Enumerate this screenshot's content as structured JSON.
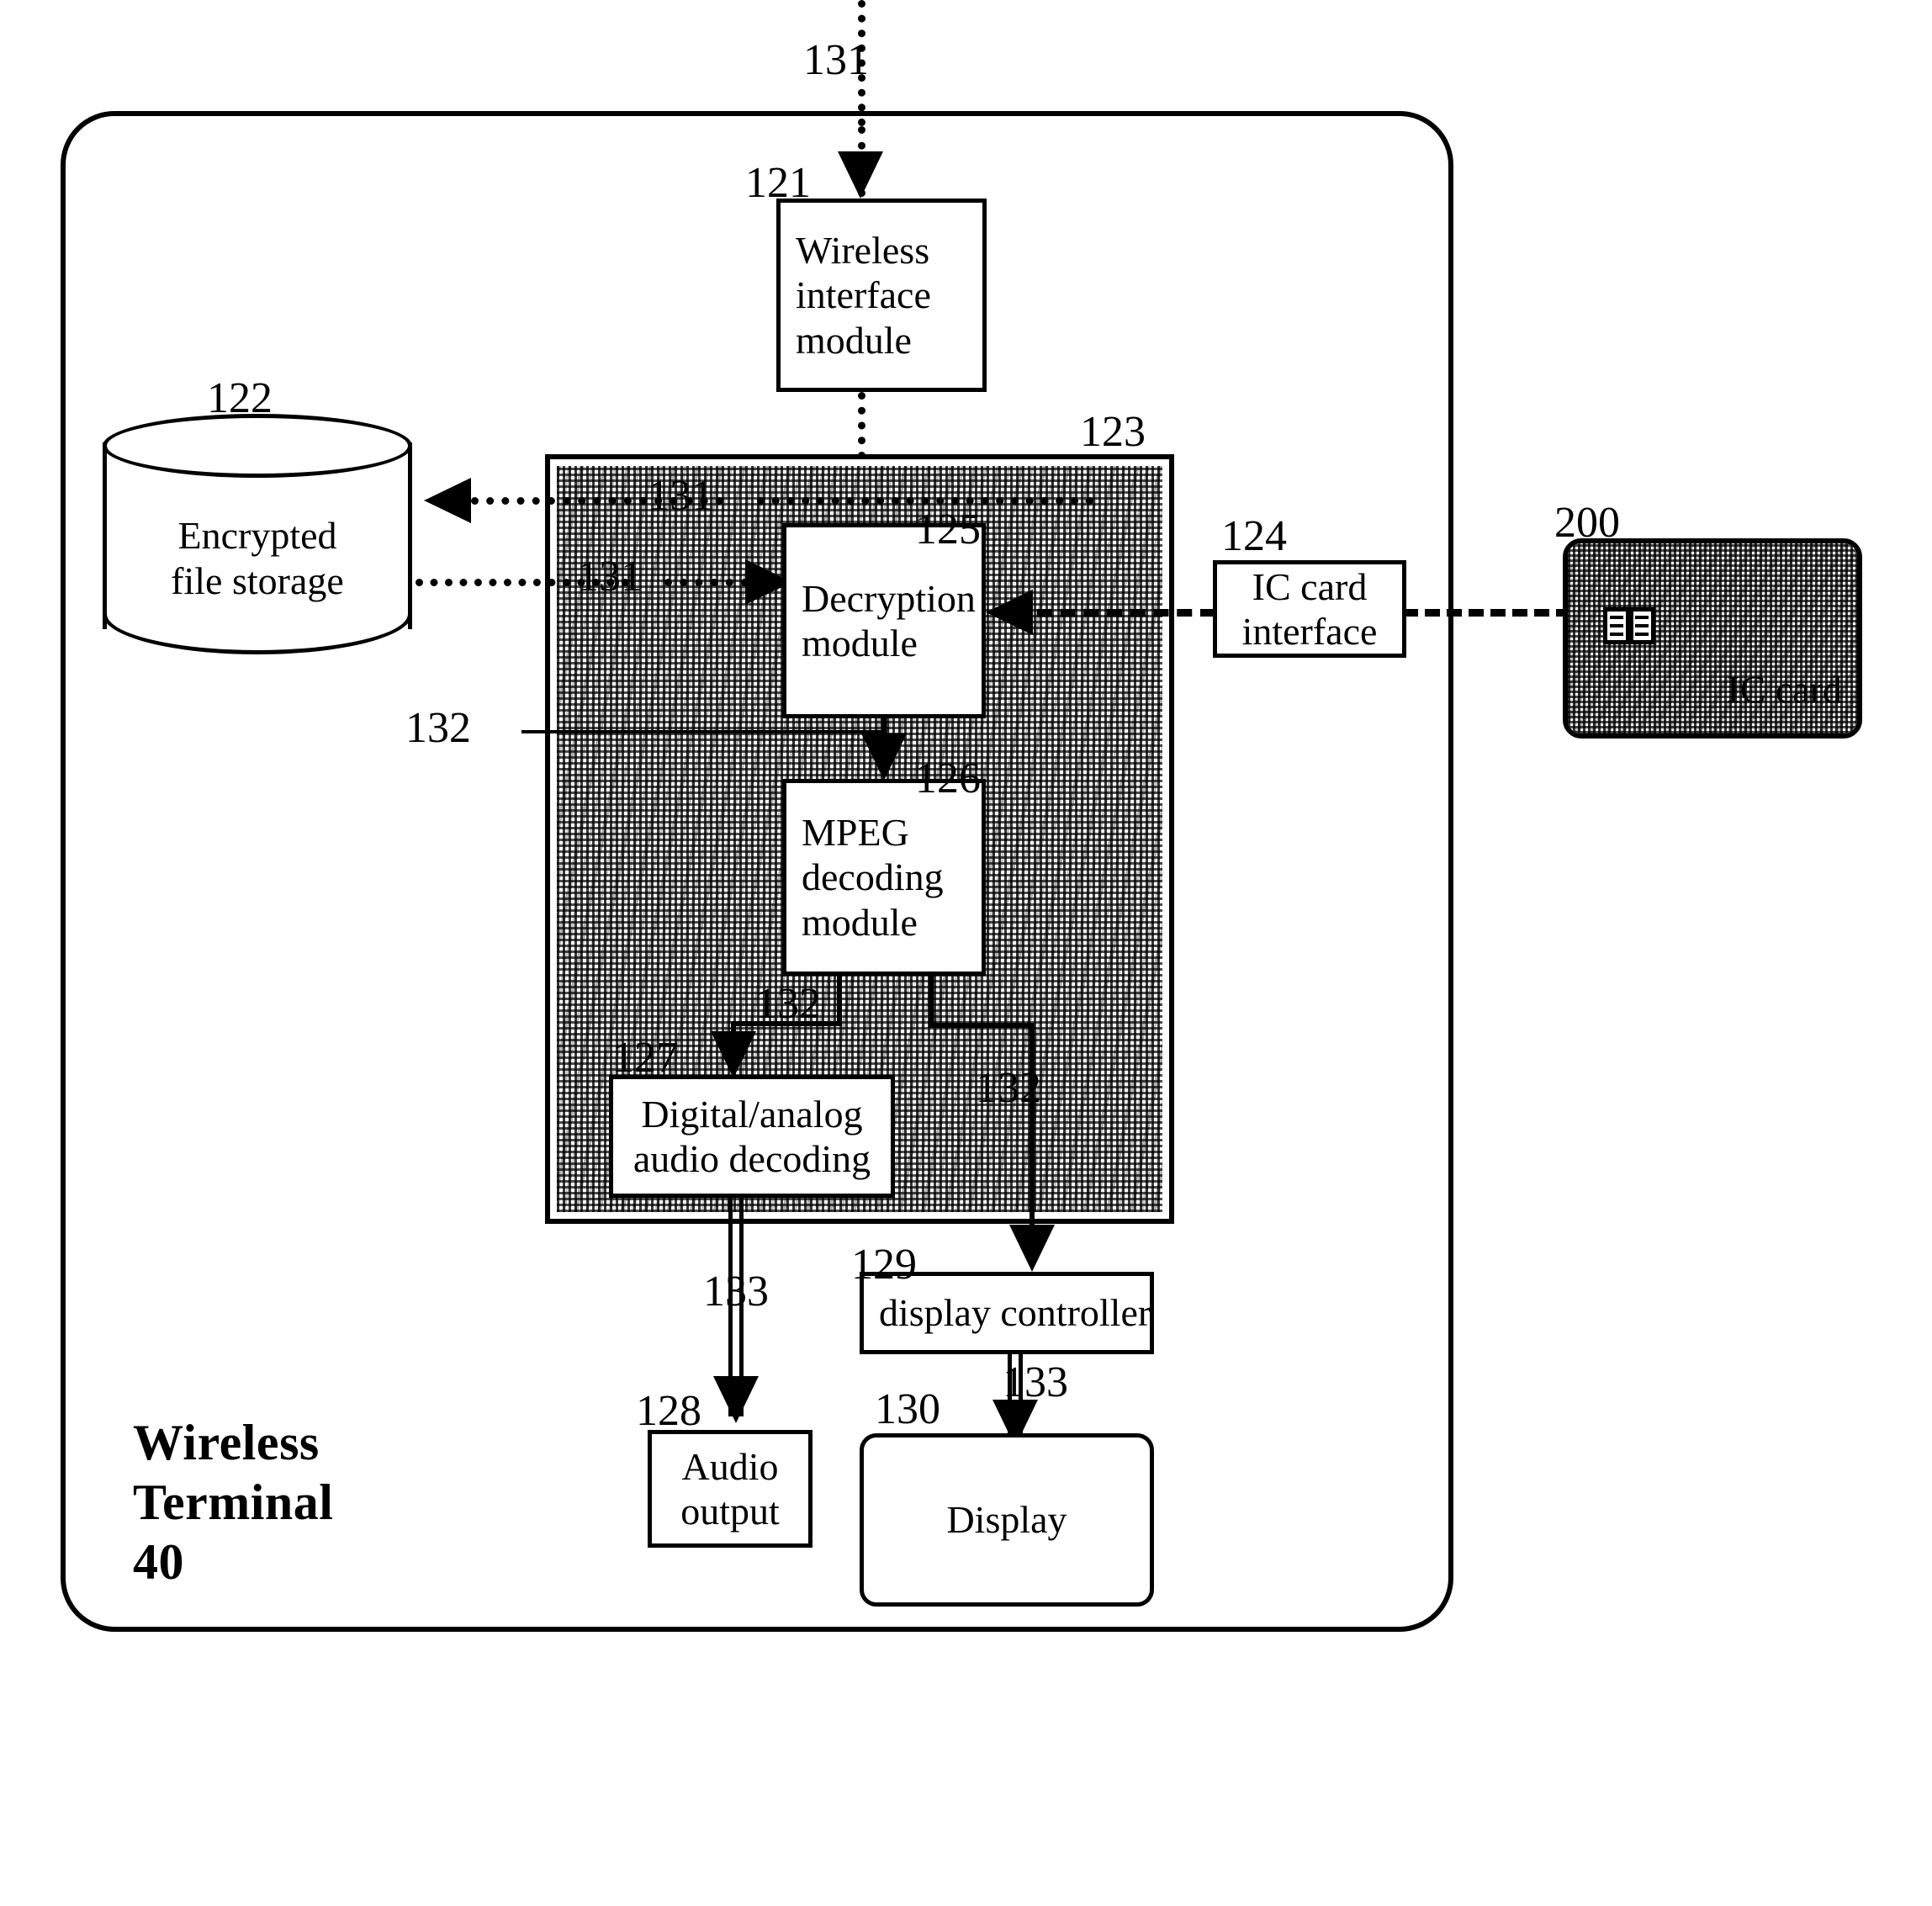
{
  "figure": {
    "terminal": {
      "caption": "Wireless\nTerminal\n40",
      "ref": "40"
    },
    "blocks": [
      {
        "ref": "121",
        "label": "Wireless\ninterface\nmodule"
      },
      {
        "ref": "122",
        "label": "Encrypted\nfile storage"
      },
      {
        "ref": "123",
        "label": ""
      },
      {
        "ref": "124",
        "label": "IC card\ninterface"
      },
      {
        "ref": "125",
        "label": "Decryption\nmodule"
      },
      {
        "ref": "126",
        "label": "MPEG\ndecoding\nmodule"
      },
      {
        "ref": "127",
        "label": "Digital/analog\naudio decoding"
      },
      {
        "ref": "128",
        "label": "Audio\noutput"
      },
      {
        "ref": "129",
        "label": "display controller"
      },
      {
        "ref": "130",
        "label": "Display"
      },
      {
        "ref": "200",
        "label": "IC card"
      }
    ],
    "refs": {
      "wireless_interface": "121",
      "encrypted_storage": "122",
      "secure_region": "123",
      "ic_card_interface": "124",
      "decryption_module": "125",
      "mpeg_decoding_module": "126",
      "audio_decoding": "127",
      "audio_output": "128",
      "display_controller": "129",
      "display": "130",
      "ic_card": "200"
    },
    "signals": {
      "encrypted_stream": "131",
      "decoded_stream": "132",
      "output_stream": "133"
    },
    "signal_labels": {
      "incoming_131": "131",
      "store_131": "131",
      "read_131": "131",
      "decrypt_out_132": "132",
      "audio_branch_132": "132",
      "video_branch_132": "132",
      "audio_out_133": "133",
      "display_ctrl_in_133": "133",
      "display_in_133": "133"
    },
    "colors": {
      "ink": "#000000",
      "paper": "#ffffff"
    }
  }
}
